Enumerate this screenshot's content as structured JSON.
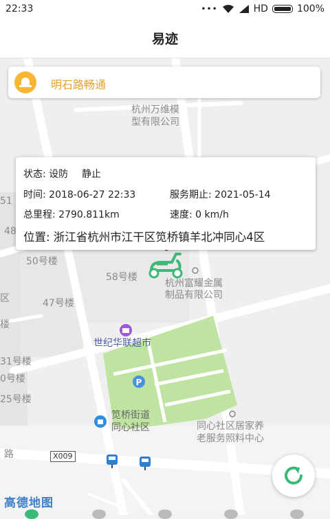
{
  "status_bar": {
    "time": "22:33",
    "network": "HD",
    "battery": "100%"
  },
  "header": {
    "title": "易迹"
  },
  "traffic": {
    "text": "明石路畅通"
  },
  "vehicle_info": {
    "status_label": "状态: 设防",
    "motion": "静止",
    "time": "时间: 2018-06-27 22:33",
    "service_expiry": "服务期止: 2021-05-14",
    "mileage": "总里程: 2790.811km",
    "speed": "速度: 0 km/h",
    "location": "位置: 浙江省杭州市江干区笕桥镇羊北冲同心4区"
  },
  "map": {
    "labels": {
      "company1_l1": "杭州万维模",
      "company1_l2": "型有限公司",
      "b51": "51",
      "b48": "48",
      "b50": "50号楼",
      "b58": "58号楼",
      "company2_l1": "杭州富耀金属",
      "company2_l2": "制品有限公司",
      "b47": "47号楼",
      "edge_qu": "区",
      "edge_lou": "楼",
      "supermarket": "世纪华联超市",
      "b31": "31号楼",
      "b0": "0号楼",
      "b25": "25号楼",
      "community_l1": "笕桥街道",
      "community_l2": "同心社区",
      "eldercare_l1": "同心社区居家养",
      "eldercare_l2": "老服务照料中心",
      "road_edge": "路",
      "road_code": "X009"
    },
    "logo": "高德地图"
  },
  "colors": {
    "accent_green": "#3cb878",
    "traffic_text": "#e4a22d",
    "park": "#bfe3a0",
    "map_bg": "#efefef"
  },
  "icons": {
    "alert": "traffic-alert-icon",
    "vehicle": "scooter-icon",
    "refresh": "refresh-icon",
    "bus": "bus-stop-icon"
  }
}
